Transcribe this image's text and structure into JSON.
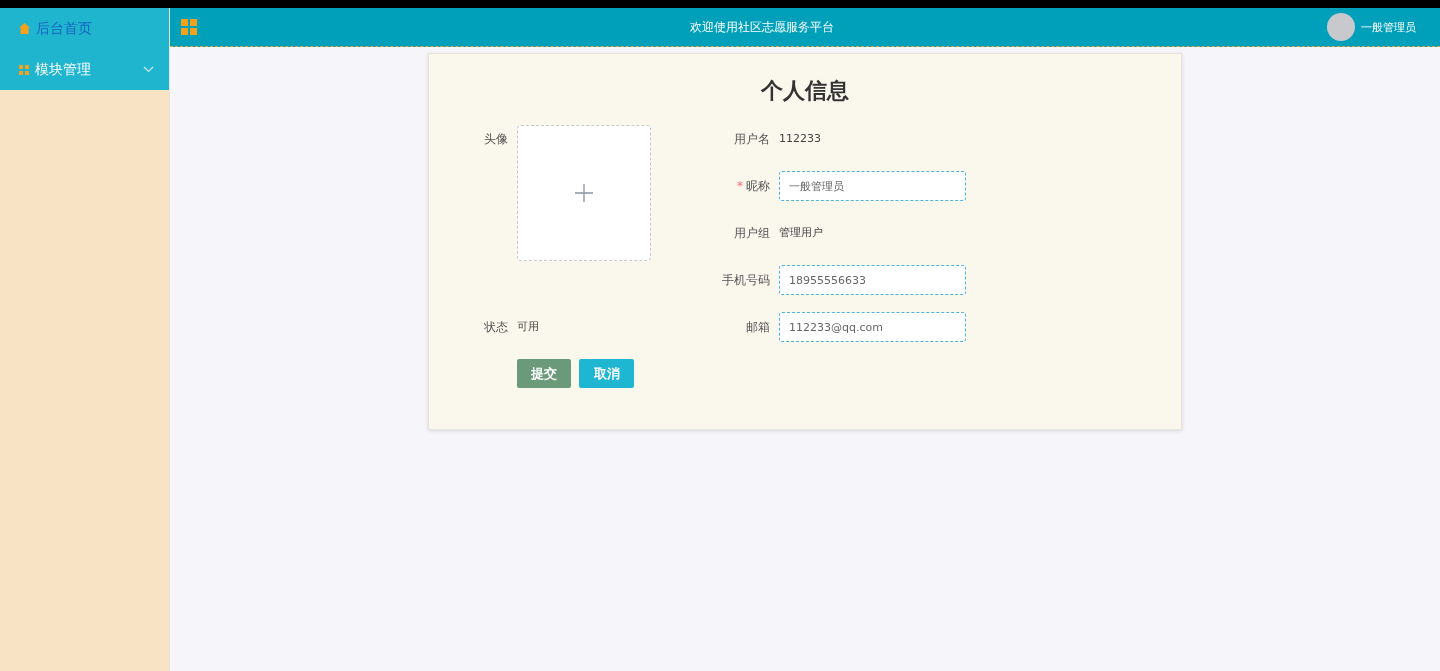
{
  "sidebar": {
    "items": [
      {
        "label": "后台首页",
        "kind": "link",
        "selected": true
      },
      {
        "label": "模块管理",
        "kind": "submenu",
        "selected": false,
        "expanded": false
      }
    ]
  },
  "header": {
    "title": "欢迎使用社区志愿服务平台",
    "user": "一般管理员"
  },
  "profile": {
    "title": "个人信息",
    "required_mark": "*",
    "avatar_label": "头像",
    "status": {
      "label": "状态",
      "value": "可用"
    },
    "fields": [
      {
        "label": "用户名",
        "kind": "text",
        "value": "112233",
        "required": false
      },
      {
        "label": "昵称",
        "kind": "input",
        "value": "一般管理员",
        "required": true
      },
      {
        "label": "用户组",
        "kind": "text",
        "value": "管理用户",
        "required": false
      },
      {
        "label": "手机号码",
        "kind": "input",
        "value": "18955556633",
        "required": false
      },
      {
        "label": "邮箱",
        "kind": "input",
        "value": "112233@qq.com",
        "required": false
      }
    ],
    "buttons": [
      {
        "label": "提交",
        "kind": "submit"
      },
      {
        "label": "取消",
        "kind": "cancel"
      }
    ]
  }
}
